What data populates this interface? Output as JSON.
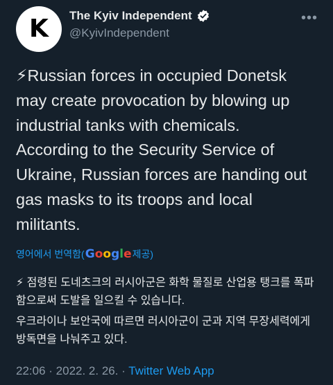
{
  "account": {
    "avatar_letter": "K",
    "display_name": "The Kyiv Independent",
    "handle": "@KyivIndependent",
    "verified": true
  },
  "tweet": {
    "paragraph1": "⚡Russian forces in occupied Donetsk may create provocation by blowing up industrial tanks with chemicals.",
    "paragraph2": "According to the Security Service of Ukraine, Russian forces are handing out gas masks to its troops and local militants."
  },
  "translation": {
    "label_prefix": "영어에서 번역함(",
    "provider": "Google",
    "label_suffix": " 제공)",
    "paragraph1": "⚡ 점령된 도네츠크의 러시아군은 화학 물질로 산업용 탱크를 폭파함으로써 도발을 일으킬 수 있습니다.",
    "paragraph2": "우크라이나 보안국에 따르면 러시아군이 군과 지역 무장세력에게 방독면을 나눠주고 있다."
  },
  "meta": {
    "time": "22:06",
    "separator": " · ",
    "date": "2022. 2. 26.",
    "source": "Twitter Web App"
  },
  "colors": {
    "background": "#15202b",
    "text": "#e7e9ea",
    "secondary": "#8b98a5",
    "accent": "#1d9bf0"
  },
  "icons": {
    "verified": "verified-badge-icon",
    "more": "more-horizontal-icon"
  }
}
